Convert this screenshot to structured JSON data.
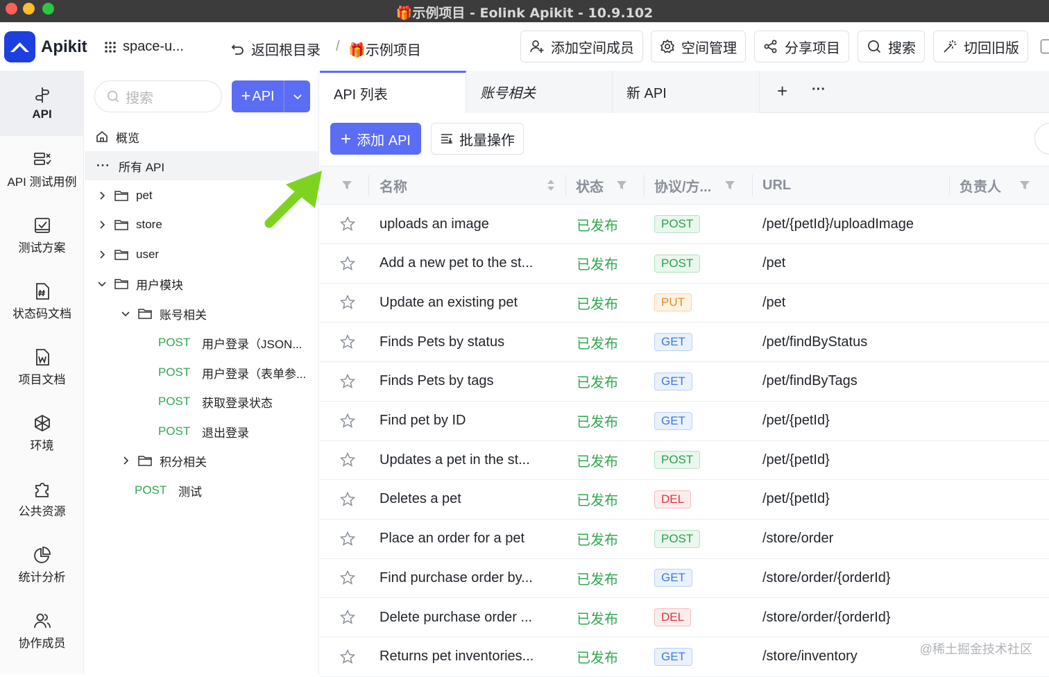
{
  "window": {
    "title": "🎁示例项目 - Eolink Apikit - 10.9.102"
  },
  "topbar": {
    "logo": "Apikit",
    "space": "space-u...",
    "back": "返回根目录",
    "separator": "/",
    "project": "🎁示例项目",
    "buttons": {
      "add_member": "添加空间成员",
      "space_manage": "空间管理",
      "share": "分享项目",
      "search": "搜索",
      "old_version": "切回旧版"
    }
  },
  "leftnav": [
    {
      "label": "API",
      "icon": "api-icon"
    },
    {
      "label": "API 测试用例",
      "icon": "test-case-icon"
    },
    {
      "label": "测试方案",
      "icon": "test-plan-icon"
    },
    {
      "label": "状态码文档",
      "icon": "status-code-icon"
    },
    {
      "label": "项目文档",
      "icon": "word-doc-icon"
    },
    {
      "label": "环境",
      "icon": "environment-icon"
    },
    {
      "label": "公共资源",
      "icon": "puzzle-icon"
    },
    {
      "label": "统计分析",
      "icon": "pie-chart-icon"
    },
    {
      "label": "协作成员",
      "icon": "members-icon"
    }
  ],
  "tree": {
    "search_placeholder": "搜索",
    "add_button": "API",
    "overview": "概览",
    "all_api": "所有 API",
    "folders": {
      "pet": "pet",
      "store": "store",
      "user": "user",
      "user_module": "用户模块",
      "account": "账号相关",
      "points": "积分相关"
    },
    "account_apis": [
      {
        "method": "POST",
        "name": "用户登录（JSON..."
      },
      {
        "method": "POST",
        "name": "用户登录（表单参..."
      },
      {
        "method": "POST",
        "name": "获取登录状态"
      },
      {
        "method": "POST",
        "name": "退出登录"
      }
    ],
    "test_api": {
      "method": "POST",
      "name": "测试"
    }
  },
  "tabs": [
    "API 列表",
    "账号相关",
    "新 API"
  ],
  "toolbar": {
    "add_api": "添加 API",
    "batch": "批量操作"
  },
  "table": {
    "headers": {
      "name": "名称",
      "status": "状态",
      "protocol": "协议/方...",
      "url": "URL",
      "owner": "负责人"
    },
    "rows": [
      {
        "name": "uploads an image",
        "status": "已发布",
        "method": "POST",
        "url": "/pet/{petId}/uploadImage"
      },
      {
        "name": "Add a new pet to the st...",
        "status": "已发布",
        "method": "POST",
        "url": "/pet"
      },
      {
        "name": "Update an existing pet",
        "status": "已发布",
        "method": "PUT",
        "url": "/pet"
      },
      {
        "name": "Finds Pets by status",
        "status": "已发布",
        "method": "GET",
        "url": "/pet/findByStatus"
      },
      {
        "name": "Finds Pets by tags",
        "status": "已发布",
        "method": "GET",
        "url": "/pet/findByTags"
      },
      {
        "name": "Find pet by ID",
        "status": "已发布",
        "method": "GET",
        "url": "/pet/{petId}"
      },
      {
        "name": "Updates a pet in the st...",
        "status": "已发布",
        "method": "POST",
        "url": "/pet/{petId}"
      },
      {
        "name": "Deletes a pet",
        "status": "已发布",
        "method": "DEL",
        "url": "/pet/{petId}"
      },
      {
        "name": "Place an order for a pet",
        "status": "已发布",
        "method": "POST",
        "url": "/store/order"
      },
      {
        "name": "Find purchase order by...",
        "status": "已发布",
        "method": "GET",
        "url": "/store/order/{orderId}"
      },
      {
        "name": "Delete purchase order ...",
        "status": "已发布",
        "method": "DEL",
        "url": "/store/order/{orderId}"
      },
      {
        "name": "Returns pet inventories...",
        "status": "已发布",
        "method": "GET",
        "url": "/store/inventory"
      }
    ]
  },
  "watermark": "@稀土掘金技术社区",
  "colors": {
    "accent": "#5b6cf5",
    "brand": "#1c3fdf",
    "published": "#2fa94f",
    "arrow": "#7ed321"
  }
}
